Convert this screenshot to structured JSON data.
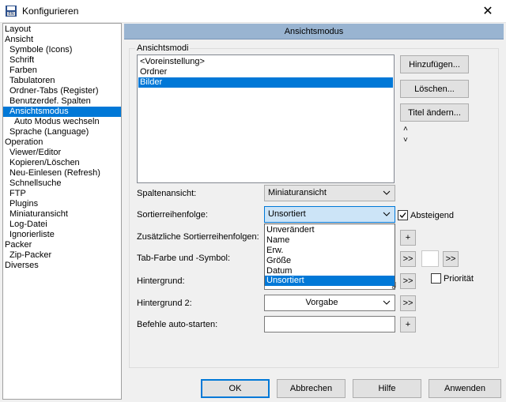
{
  "window": {
    "title": "Konfigurieren",
    "close_glyph": "✕"
  },
  "tree": {
    "items": [
      {
        "label": "Layout",
        "level": 0
      },
      {
        "label": "Ansicht",
        "level": 0
      },
      {
        "label": "Symbole (Icons)",
        "level": 1
      },
      {
        "label": "Schrift",
        "level": 1
      },
      {
        "label": "Farben",
        "level": 1
      },
      {
        "label": "Tabulatoren",
        "level": 1
      },
      {
        "label": "Ordner-Tabs (Register)",
        "level": 1
      },
      {
        "label": "Benutzerdef. Spalten",
        "level": 1
      },
      {
        "label": "Ansichtsmodus",
        "level": 1,
        "selected": true
      },
      {
        "label": "Auto Modus wechseln",
        "level": 2
      },
      {
        "label": "Sprache (Language)",
        "level": 1
      },
      {
        "label": "Operation",
        "level": 0
      },
      {
        "label": "Viewer/Editor",
        "level": 1
      },
      {
        "label": "Kopieren/Löschen",
        "level": 1
      },
      {
        "label": "Neu-Einlesen (Refresh)",
        "level": 1
      },
      {
        "label": "Schnellsuche",
        "level": 1
      },
      {
        "label": "FTP",
        "level": 1
      },
      {
        "label": "Plugins",
        "level": 1
      },
      {
        "label": "Miniaturansicht",
        "level": 1
      },
      {
        "label": "Log-Datei",
        "level": 1
      },
      {
        "label": "Ignorierliste",
        "level": 1
      },
      {
        "label": "Packer",
        "level": 0
      },
      {
        "label": "Zip-Packer",
        "level": 1
      },
      {
        "label": "Diverses",
        "level": 0
      }
    ]
  },
  "header": {
    "title": "Ansichtsmodus"
  },
  "group": {
    "legend": "Ansichtsmodi",
    "list_items": [
      "<Voreinstellung>",
      "Ordner",
      "Bilder"
    ],
    "selected_index": 2
  },
  "buttons": {
    "add": "Hinzufügen...",
    "delete": "Löschen...",
    "rename": "Titel ändern...",
    "up_glyph": "˄",
    "down_glyph": "˅",
    "more": ">>",
    "plus": "+"
  },
  "fields": {
    "column_view_label": "Spaltenansicht:",
    "column_view_value": "Miniaturansicht",
    "sort_order_label": "Sortierreihenfolge:",
    "sort_order_value": "Unsortiert",
    "descending_label": "Absteigend",
    "descending_checked": true,
    "extra_sort_label": "Zusätzliche Sortierreihenfolgen:",
    "tab_color_label": "Tab-Farbe und -Symbol:",
    "background_label": "Hintergrund:",
    "background_partial": "g",
    "priority_label": "Priorität",
    "priority_checked": false,
    "background2_label": "Hintergrund 2:",
    "background2_value": "Vorgabe",
    "autostart_label": "Befehle auto-starten:"
  },
  "dropdown": {
    "options": [
      "Unverändert",
      "Name",
      "Erw.",
      "Größe",
      "Datum",
      "Unsortiert"
    ],
    "selected_index": 5
  },
  "footer": {
    "ok": "OK",
    "cancel": "Abbrechen",
    "help": "Hilfe",
    "apply": "Anwenden"
  },
  "colors": {
    "accent": "#0078d7",
    "header_bg": "#99b4d1"
  }
}
